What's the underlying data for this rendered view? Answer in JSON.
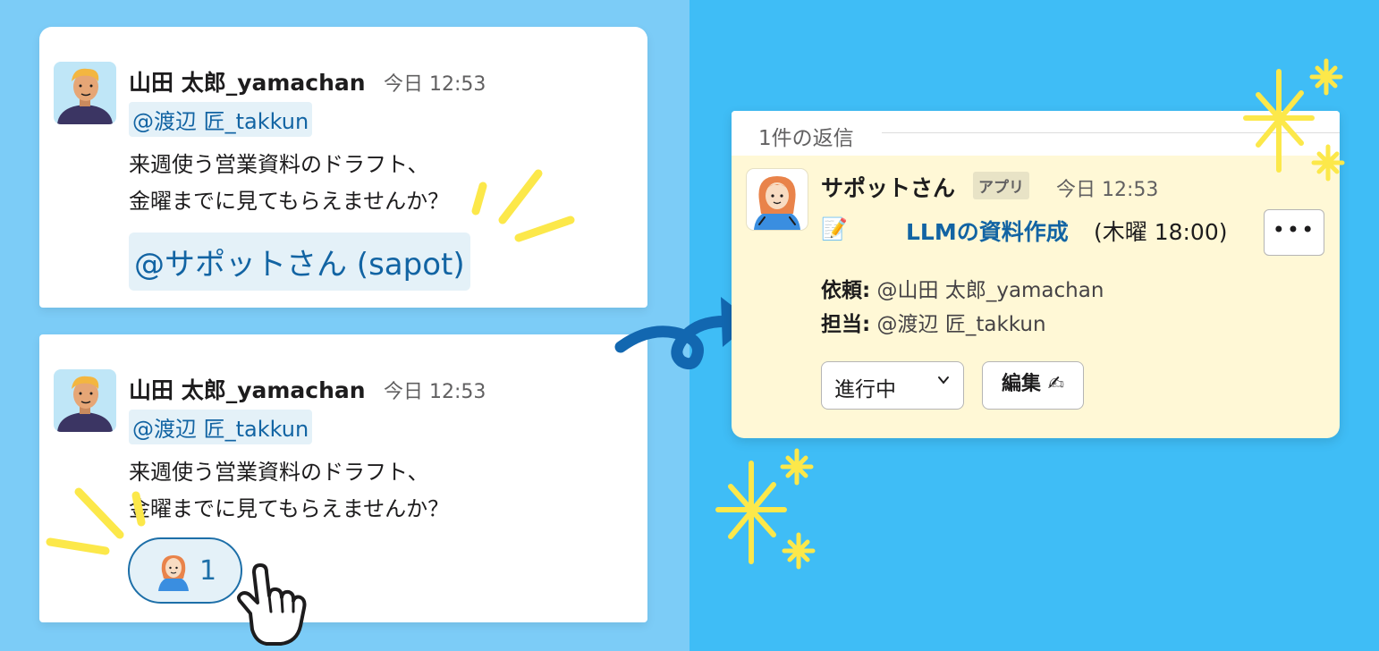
{
  "message1": {
    "username": "山田 太郎_yamachan",
    "time": "今日 12:53",
    "mention": "@渡辺 匠_takkun",
    "line1": "来週使う営業資料のドラフト、",
    "line2": "金曜までに見てもらえませんか？",
    "bot_mention": "@サポットさん (sapot)"
  },
  "message2": {
    "username": "山田 太郎_yamachan",
    "time": "今日 12:53",
    "mention": "@渡辺 匠_takkun",
    "line1": "来週使う営業資料のドラフト、",
    "line2": "金曜までに見てもらえませんか？",
    "reply_count": "1"
  },
  "thread": {
    "reply_label": "1件の返信",
    "bot_name": "サポットさん",
    "app_badge": "アプリ",
    "time": "今日 12:53",
    "memo_icon": "📝",
    "task_title": "LLMの資料作成",
    "task_when": "(木曜 18:00)",
    "more_label": "•••",
    "requester_label": "依頼:",
    "requester_value": "@山田 太郎_yamachan",
    "assignee_label": "担当:",
    "assignee_value": "@渡辺 匠_takkun",
    "status": "進行中",
    "edit_label": "編集 ✍"
  },
  "colors": {
    "left_bg": "#7cccf7",
    "right_bg": "#3fbdf6",
    "mention": "#1264a3",
    "thread_bg": "#fff8d6",
    "sparkle": "#fce84a",
    "arrow": "#1267b0"
  },
  "icons": [
    "user-avatar-icon",
    "bot-avatar-icon",
    "memo-icon",
    "chevron-down-icon",
    "pointer-hand-icon",
    "sparkle-icon",
    "curly-arrow-icon"
  ]
}
